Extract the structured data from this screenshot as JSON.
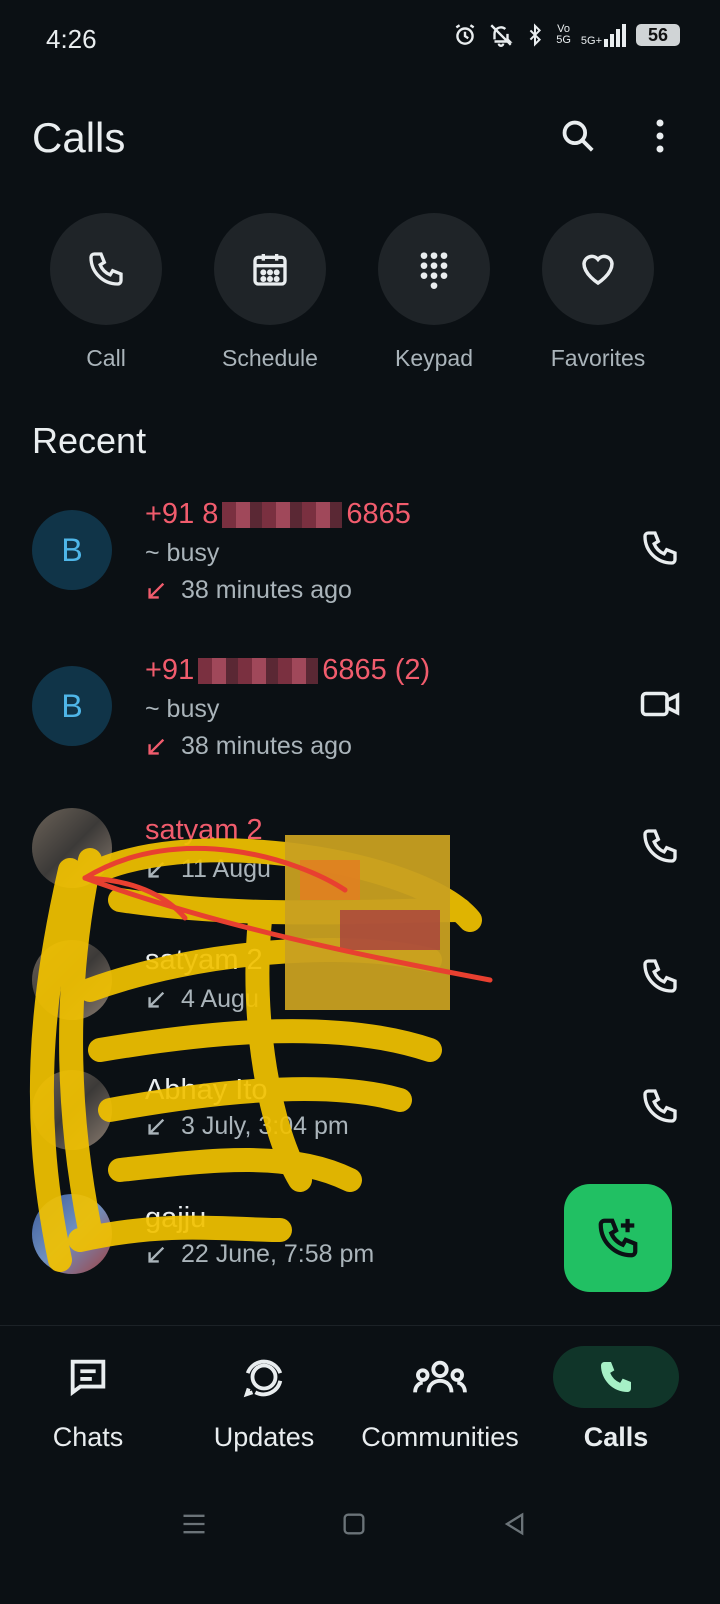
{
  "status_bar": {
    "time": "4:26",
    "battery": "56",
    "network": "5G+"
  },
  "header": {
    "title": "Calls"
  },
  "quick_actions": [
    {
      "label": "Call",
      "icon": "phone-icon"
    },
    {
      "label": "Schedule",
      "icon": "calendar-icon"
    },
    {
      "label": "Keypad",
      "icon": "keypad-icon"
    },
    {
      "label": "Favorites",
      "icon": "heart-icon"
    }
  ],
  "recent": {
    "title": "Recent",
    "items": [
      {
        "avatar_letter": "B",
        "name_prefix": "+91 8",
        "name_suffix": "6865",
        "subtitle": "~ busy",
        "time": "38 minutes ago",
        "missed": true,
        "action": "phone-icon"
      },
      {
        "avatar_letter": "B",
        "name_prefix": "+91",
        "name_suffix": "6865 (2)",
        "subtitle": "~ busy",
        "time": "38 minutes ago",
        "missed": true,
        "action": "video-icon"
      },
      {
        "name": "satyam 2",
        "time": "11 Augu",
        "action": "phone-icon"
      },
      {
        "name": "satyam 2",
        "time": "4 Augu",
        "action": "phone-icon"
      },
      {
        "name": "Abhay Ito",
        "time": "3 July, 3:04 pm",
        "action": "phone-icon"
      },
      {
        "name": "gajju",
        "time": "22 June, 7:58 pm"
      }
    ]
  },
  "colors": {
    "accent": "#21c063",
    "missed": "#f15c6d",
    "background": "#0b1014"
  },
  "bottom_nav": [
    {
      "label": "Chats",
      "icon": "chats-icon"
    },
    {
      "label": "Updates",
      "icon": "updates-icon"
    },
    {
      "label": "Communities",
      "icon": "communities-icon"
    },
    {
      "label": "Calls",
      "icon": "calls-icon",
      "active": true
    }
  ]
}
